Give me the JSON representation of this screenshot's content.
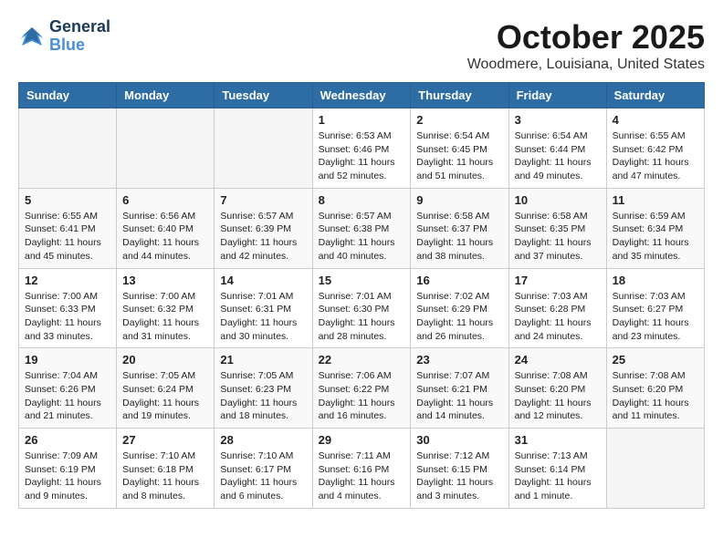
{
  "header": {
    "logo_line1": "General",
    "logo_line2": "Blue",
    "title": "October 2025",
    "location": "Woodmere, Louisiana, United States"
  },
  "weekdays": [
    "Sunday",
    "Monday",
    "Tuesday",
    "Wednesday",
    "Thursday",
    "Friday",
    "Saturday"
  ],
  "weeks": [
    [
      {
        "day": "",
        "info": ""
      },
      {
        "day": "",
        "info": ""
      },
      {
        "day": "",
        "info": ""
      },
      {
        "day": "1",
        "info": "Sunrise: 6:53 AM\nSunset: 6:46 PM\nDaylight: 11 hours\nand 52 minutes."
      },
      {
        "day": "2",
        "info": "Sunrise: 6:54 AM\nSunset: 6:45 PM\nDaylight: 11 hours\nand 51 minutes."
      },
      {
        "day": "3",
        "info": "Sunrise: 6:54 AM\nSunset: 6:44 PM\nDaylight: 11 hours\nand 49 minutes."
      },
      {
        "day": "4",
        "info": "Sunrise: 6:55 AM\nSunset: 6:42 PM\nDaylight: 11 hours\nand 47 minutes."
      }
    ],
    [
      {
        "day": "5",
        "info": "Sunrise: 6:55 AM\nSunset: 6:41 PM\nDaylight: 11 hours\nand 45 minutes."
      },
      {
        "day": "6",
        "info": "Sunrise: 6:56 AM\nSunset: 6:40 PM\nDaylight: 11 hours\nand 44 minutes."
      },
      {
        "day": "7",
        "info": "Sunrise: 6:57 AM\nSunset: 6:39 PM\nDaylight: 11 hours\nand 42 minutes."
      },
      {
        "day": "8",
        "info": "Sunrise: 6:57 AM\nSunset: 6:38 PM\nDaylight: 11 hours\nand 40 minutes."
      },
      {
        "day": "9",
        "info": "Sunrise: 6:58 AM\nSunset: 6:37 PM\nDaylight: 11 hours\nand 38 minutes."
      },
      {
        "day": "10",
        "info": "Sunrise: 6:58 AM\nSunset: 6:35 PM\nDaylight: 11 hours\nand 37 minutes."
      },
      {
        "day": "11",
        "info": "Sunrise: 6:59 AM\nSunset: 6:34 PM\nDaylight: 11 hours\nand 35 minutes."
      }
    ],
    [
      {
        "day": "12",
        "info": "Sunrise: 7:00 AM\nSunset: 6:33 PM\nDaylight: 11 hours\nand 33 minutes."
      },
      {
        "day": "13",
        "info": "Sunrise: 7:00 AM\nSunset: 6:32 PM\nDaylight: 11 hours\nand 31 minutes."
      },
      {
        "day": "14",
        "info": "Sunrise: 7:01 AM\nSunset: 6:31 PM\nDaylight: 11 hours\nand 30 minutes."
      },
      {
        "day": "15",
        "info": "Sunrise: 7:01 AM\nSunset: 6:30 PM\nDaylight: 11 hours\nand 28 minutes."
      },
      {
        "day": "16",
        "info": "Sunrise: 7:02 AM\nSunset: 6:29 PM\nDaylight: 11 hours\nand 26 minutes."
      },
      {
        "day": "17",
        "info": "Sunrise: 7:03 AM\nSunset: 6:28 PM\nDaylight: 11 hours\nand 24 minutes."
      },
      {
        "day": "18",
        "info": "Sunrise: 7:03 AM\nSunset: 6:27 PM\nDaylight: 11 hours\nand 23 minutes."
      }
    ],
    [
      {
        "day": "19",
        "info": "Sunrise: 7:04 AM\nSunset: 6:26 PM\nDaylight: 11 hours\nand 21 minutes."
      },
      {
        "day": "20",
        "info": "Sunrise: 7:05 AM\nSunset: 6:24 PM\nDaylight: 11 hours\nand 19 minutes."
      },
      {
        "day": "21",
        "info": "Sunrise: 7:05 AM\nSunset: 6:23 PM\nDaylight: 11 hours\nand 18 minutes."
      },
      {
        "day": "22",
        "info": "Sunrise: 7:06 AM\nSunset: 6:22 PM\nDaylight: 11 hours\nand 16 minutes."
      },
      {
        "day": "23",
        "info": "Sunrise: 7:07 AM\nSunset: 6:21 PM\nDaylight: 11 hours\nand 14 minutes."
      },
      {
        "day": "24",
        "info": "Sunrise: 7:08 AM\nSunset: 6:20 PM\nDaylight: 11 hours\nand 12 minutes."
      },
      {
        "day": "25",
        "info": "Sunrise: 7:08 AM\nSunset: 6:20 PM\nDaylight: 11 hours\nand 11 minutes."
      }
    ],
    [
      {
        "day": "26",
        "info": "Sunrise: 7:09 AM\nSunset: 6:19 PM\nDaylight: 11 hours\nand 9 minutes."
      },
      {
        "day": "27",
        "info": "Sunrise: 7:10 AM\nSunset: 6:18 PM\nDaylight: 11 hours\nand 8 minutes."
      },
      {
        "day": "28",
        "info": "Sunrise: 7:10 AM\nSunset: 6:17 PM\nDaylight: 11 hours\nand 6 minutes."
      },
      {
        "day": "29",
        "info": "Sunrise: 7:11 AM\nSunset: 6:16 PM\nDaylight: 11 hours\nand 4 minutes."
      },
      {
        "day": "30",
        "info": "Sunrise: 7:12 AM\nSunset: 6:15 PM\nDaylight: 11 hours\nand 3 minutes."
      },
      {
        "day": "31",
        "info": "Sunrise: 7:13 AM\nSunset: 6:14 PM\nDaylight: 11 hours\nand 1 minute."
      },
      {
        "day": "",
        "info": ""
      }
    ]
  ]
}
